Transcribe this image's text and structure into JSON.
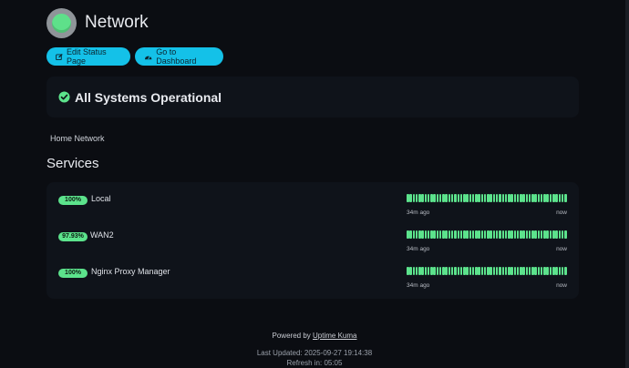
{
  "header": {
    "title": "Network"
  },
  "toolbar": {
    "edit_label": "Edit Status Page",
    "dashboard_label": "Go to Dashboard"
  },
  "status": {
    "text": "All Systems Operational"
  },
  "description": "Home Network",
  "services": {
    "title": "Services",
    "items": [
      {
        "uptime": "100%",
        "name": "Local",
        "beats": 54,
        "time_start": "34m ago",
        "time_end": "now"
      },
      {
        "uptime": "97.93%",
        "name": "WAN2",
        "beats": 54,
        "time_start": "34m ago",
        "time_end": "now"
      },
      {
        "uptime": "100%",
        "name": "Nginx Proxy Manager",
        "beats": 54,
        "time_start": "34m ago",
        "time_end": "now"
      }
    ]
  },
  "footer": {
    "powered_by": "Powered by",
    "link": "Uptime Kuma",
    "last_updated": "Last Updated: 2025-09-27 19:14:38",
    "refresh": "Refresh in: 05:05"
  },
  "colors": {
    "accent": "#14c1e8",
    "up": "#5ce38c",
    "background": "#0b0d12",
    "card": "#0f131a"
  },
  "icons": {
    "edit": "edit-icon",
    "dashboard": "gauge-icon",
    "status": "check-circle-icon"
  }
}
